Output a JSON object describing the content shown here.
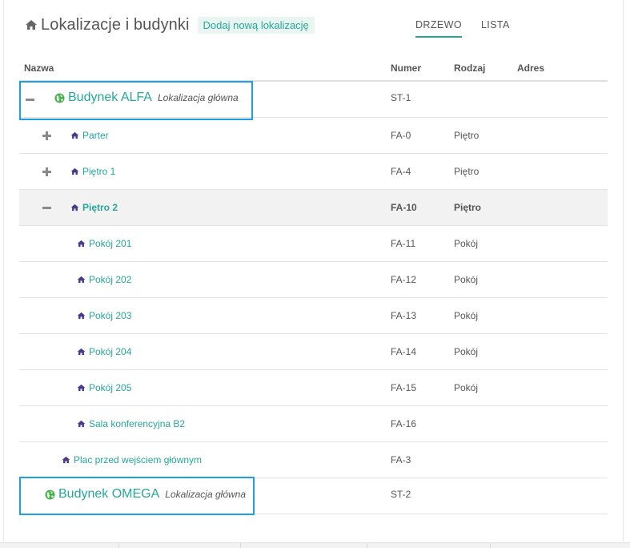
{
  "header": {
    "title": "Lokalizacje i budynki",
    "add_button": "Dodaj nową lokalizację",
    "title_icon": "home-icon"
  },
  "tabs": [
    {
      "label": "DRZEWO",
      "active": true
    },
    {
      "label": "LISTA",
      "active": false
    }
  ],
  "columns": {
    "name": "Nazwa",
    "number": "Numer",
    "kind": "Rodzaj",
    "address": "Adres"
  },
  "rows": [
    {
      "name": "Budynek ALFA",
      "sub": "Lokalizacja główna",
      "number": "ST-1",
      "kind": "",
      "level": 0,
      "toggle": "minus",
      "icon": "globe-icon"
    },
    {
      "name": "Parter",
      "number": "FA-0",
      "kind": "Piętro",
      "level": 1,
      "toggle": "plus",
      "icon": "home-icon"
    },
    {
      "name": "Piętro 1",
      "number": "FA-4",
      "kind": "Piętro",
      "level": 1,
      "toggle": "plus",
      "icon": "home-icon"
    },
    {
      "name": "Piętro 2",
      "number": "FA-10",
      "kind": "Piętro",
      "level": 1,
      "toggle": "minus",
      "icon": "home-icon",
      "selected": true
    },
    {
      "name": "Pokój 201",
      "number": "FA-11",
      "kind": "Pokój",
      "level": 2,
      "icon": "home-icon"
    },
    {
      "name": "Pokój 202",
      "number": "FA-12",
      "kind": "Pokój",
      "level": 2,
      "icon": "home-icon"
    },
    {
      "name": "Pokój 203",
      "number": "FA-13",
      "kind": "Pokój",
      "level": 2,
      "icon": "home-icon"
    },
    {
      "name": "Pokój 204",
      "number": "FA-14",
      "kind": "Pokój",
      "level": 2,
      "icon": "home-icon"
    },
    {
      "name": "Pokój 205",
      "number": "FA-15",
      "kind": "Pokój",
      "level": 2,
      "icon": "home-icon"
    },
    {
      "name": "Sala konferencyjna B2",
      "number": "FA-16",
      "kind": "",
      "level": 2,
      "icon": "home-icon"
    },
    {
      "name": "Plac przed wejściem głównym",
      "number": "FA-3",
      "kind": "",
      "level": 1,
      "icon": "home-icon"
    },
    {
      "name": "Budynek OMEGA",
      "sub": "Lokalizacja główna",
      "number": "ST-2",
      "kind": "",
      "level": 0,
      "icon": "globe-icon"
    }
  ],
  "colors": {
    "accent": "#26a69a",
    "house_icon": "#4a3a8a",
    "globe_icon": "#4caf50",
    "highlight": "#1ea0e0"
  }
}
